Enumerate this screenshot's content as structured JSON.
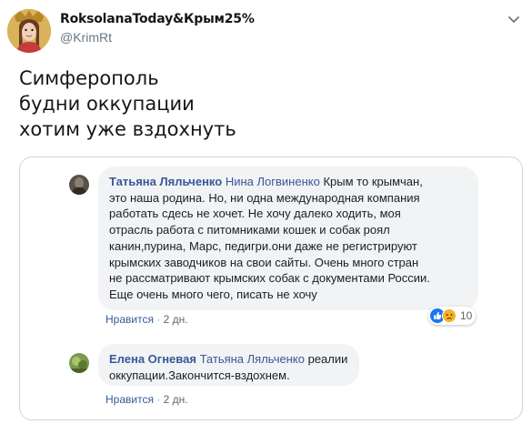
{
  "tweet": {
    "display_name": "RoksolanaToday&Крым25%",
    "handle": "@KrimRt",
    "text_lines": [
      "Симферополь",
      "будни оккупации",
      "хотим уже вздохнуть"
    ]
  },
  "comments": [
    {
      "author": "Татьяна Ляльченко",
      "tagged": "Нина Логвиненко",
      "lines": [
        "Крым то крымчан,",
        "это наша родина. Но, ни одна международная компания",
        "работать сдесь не хочет. Не хочу далеко ходить, моя",
        "отрасль работа с питомниками кошек и собак роял",
        "канин,пурина, Марс, педигри.они даже не регистрируют",
        "крымских заводчиков на свои сайты. Очень много стран",
        "не рассматривают крымских собак с документами России.",
        "Еще очень много чего, писать не хочу"
      ],
      "like_label": "Нравится",
      "time": "2 дн.",
      "reaction_count": "10",
      "reaction_icons": [
        "like-icon",
        "sad-icon"
      ]
    },
    {
      "author": "Елена Огневая",
      "tagged": "Татьяна Ляльченко",
      "lines": [
        "реалии",
        "оккупации.Закончится-вздохнем."
      ],
      "like_label": "Нравится",
      "time": "2 дн."
    }
  ],
  "colors": {
    "link_blue": "#385898",
    "bubble_bg": "#f2f3f5",
    "handle_gray": "#657786",
    "like_blue": "#1877f2",
    "sad_yellow": "#f7b125"
  }
}
